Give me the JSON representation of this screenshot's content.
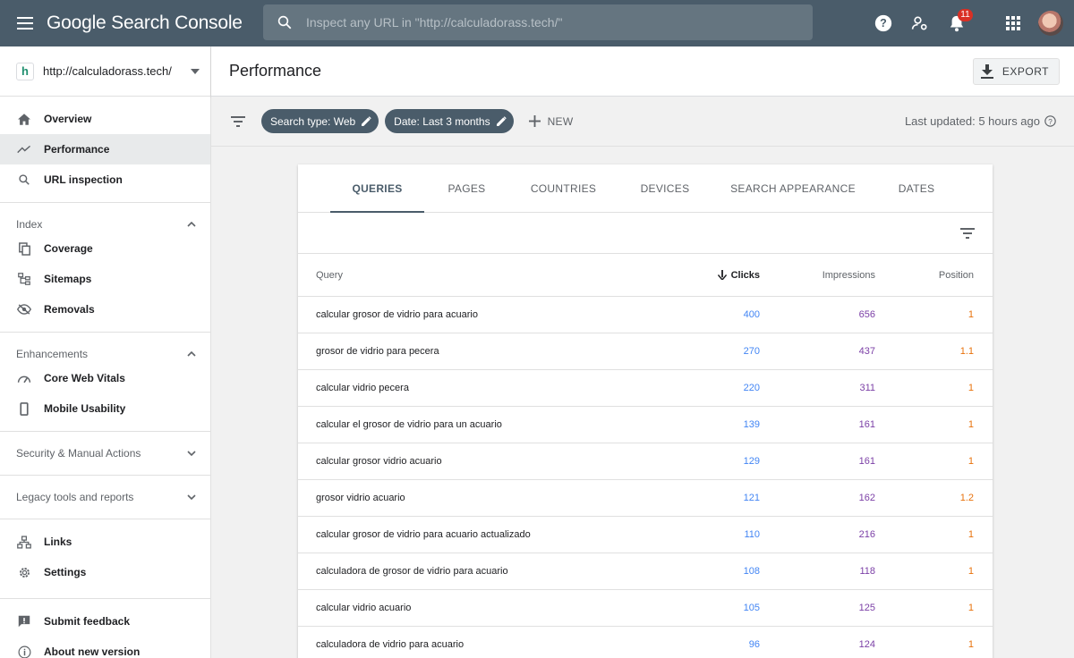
{
  "app": {
    "title": "Google Search Console"
  },
  "search": {
    "placeholder": "Inspect any URL in \"http://calculadorass.tech/\""
  },
  "top_icons": {
    "notification_count": "11"
  },
  "property": {
    "url": "http://calculadorass.tech/"
  },
  "sidebar": {
    "nav": [
      {
        "label": "Overview",
        "icon": "home-icon"
      },
      {
        "label": "Performance",
        "icon": "trending-up-icon",
        "active": true
      },
      {
        "label": "URL inspection",
        "icon": "search-icon"
      }
    ],
    "index": {
      "title": "Index",
      "items": [
        "Coverage",
        "Sitemaps",
        "Removals"
      ]
    },
    "enhancements": {
      "title": "Enhancements",
      "items": [
        "Core Web Vitals",
        "Mobile Usability"
      ]
    },
    "security": "Security & Manual Actions",
    "legacy": "Legacy tools and reports",
    "bottom": [
      "Links",
      "Settings"
    ],
    "footer": [
      "Submit feedback",
      "About new version"
    ]
  },
  "header": {
    "title": "Performance",
    "export_label": "EXPORT"
  },
  "filters": {
    "chips": [
      "Search type: Web",
      "Date: Last 3 months"
    ],
    "new_label": "NEW",
    "last_updated": "Last updated: 5 hours ago"
  },
  "tabs": [
    "QUERIES",
    "PAGES",
    "COUNTRIES",
    "DEVICES",
    "SEARCH APPEARANCE",
    "DATES"
  ],
  "table": {
    "headers": {
      "query": "Query",
      "clicks": "Clicks",
      "impressions": "Impressions",
      "position": "Position"
    },
    "rows": [
      {
        "query": "calcular grosor de vidrio para acuario",
        "clicks": "400",
        "impressions": "656",
        "position": "1"
      },
      {
        "query": "grosor de vidrio para pecera",
        "clicks": "270",
        "impressions": "437",
        "position": "1.1"
      },
      {
        "query": "calcular vidrio pecera",
        "clicks": "220",
        "impressions": "311",
        "position": "1"
      },
      {
        "query": "calcular el grosor de vidrio para un acuario",
        "clicks": "139",
        "impressions": "161",
        "position": "1"
      },
      {
        "query": "calcular grosor vidrio acuario",
        "clicks": "129",
        "impressions": "161",
        "position": "1"
      },
      {
        "query": "grosor vidrio acuario",
        "clicks": "121",
        "impressions": "162",
        "position": "1.2"
      },
      {
        "query": "calcular grosor de vidrio para acuario actualizado",
        "clicks": "110",
        "impressions": "216",
        "position": "1"
      },
      {
        "query": "calculadora de grosor de vidrio para acuario",
        "clicks": "108",
        "impressions": "118",
        "position": "1"
      },
      {
        "query": "calcular vidrio acuario",
        "clicks": "105",
        "impressions": "125",
        "position": "1"
      },
      {
        "query": "calculadora de vidrio para acuario",
        "clicks": "96",
        "impressions": "124",
        "position": "1"
      }
    ]
  },
  "colors": {
    "topbar": "#4a5c6a",
    "clicks": "#4285f4",
    "impressions": "#7b3fa6",
    "position": "#e8710a"
  }
}
